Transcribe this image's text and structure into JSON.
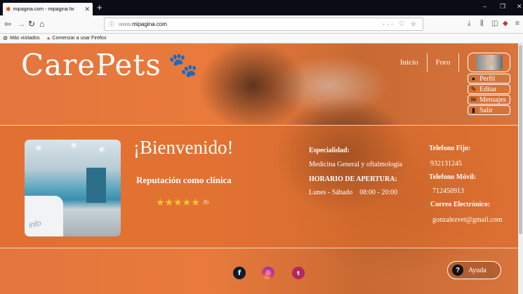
{
  "browser": {
    "tab_title": "mipagina.com - mipagina fix",
    "new_tab": "+",
    "url_domain": "mipagina.com",
    "url_prefix": "www.",
    "bookmarks": [
      "Más visitados",
      "Comenzar a usar Firefox"
    ],
    "window_controls": [
      "–",
      "❐",
      "✕"
    ]
  },
  "site": {
    "logo_text": "CarePets",
    "logo_icon": "paw-icon",
    "nav": {
      "home": "Inicio",
      "forum": "Foro"
    },
    "profile_menu": [
      {
        "label": "Perfil",
        "icon": "user-icon"
      },
      {
        "label": "Editar",
        "icon": "pencil-icon"
      },
      {
        "label": "Mensajes",
        "icon": "mail-icon"
      },
      {
        "label": "Salir",
        "icon": "exit-icon"
      }
    ],
    "welcome": "¡Bienvenido!",
    "reputation_label": "Reputación como clínica",
    "rating": {
      "stars": "★★★★★",
      "count": "(5)",
      "value": 5,
      "max": 5
    },
    "specialty_label": "Especialidad:",
    "specialty_value": "Medicina General y oftalmología",
    "hours_label": "HORARIO DE APERTURA:",
    "hours_value": "Lunes - Sábado    08:00 - 20:00",
    "landline_label": "Telefono Fijo:",
    "landline_value": "932131245",
    "mobile_label": "Telefono Móvil:",
    "mobile_value": "712450913",
    "email_label": "Correo Electrónico:",
    "email_value": "gonzalezvet@gmail.com",
    "social": [
      {
        "name": "facebook",
        "glyph": "f"
      },
      {
        "name": "instagram",
        "glyph": "◎"
      },
      {
        "name": "twitter",
        "glyph": "t"
      }
    ],
    "help_label": "Ayuda",
    "help_glyph": "?",
    "photo_caption": "info"
  }
}
